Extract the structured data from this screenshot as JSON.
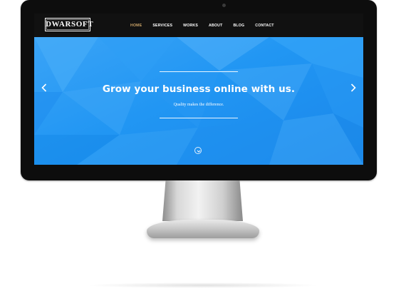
{
  "brand": {
    "logo_text": "DWARSOFT"
  },
  "nav": {
    "items": [
      {
        "label": "HOME",
        "active": true
      },
      {
        "label": "SERVICES",
        "active": false
      },
      {
        "label": "WORKS",
        "active": false
      },
      {
        "label": "ABOUT",
        "active": false
      },
      {
        "label": "BLOG",
        "active": false
      },
      {
        "label": "CONTACT",
        "active": false
      }
    ],
    "active_color": "#c9a267"
  },
  "hero": {
    "headline": "Grow your business online with us.",
    "subline": "Quality makes the difference.",
    "background_color": "#2196f3",
    "prev_icon": "chevron-left-icon",
    "next_icon": "chevron-right-icon",
    "scroll_icon": "chevron-down-circle-icon"
  }
}
